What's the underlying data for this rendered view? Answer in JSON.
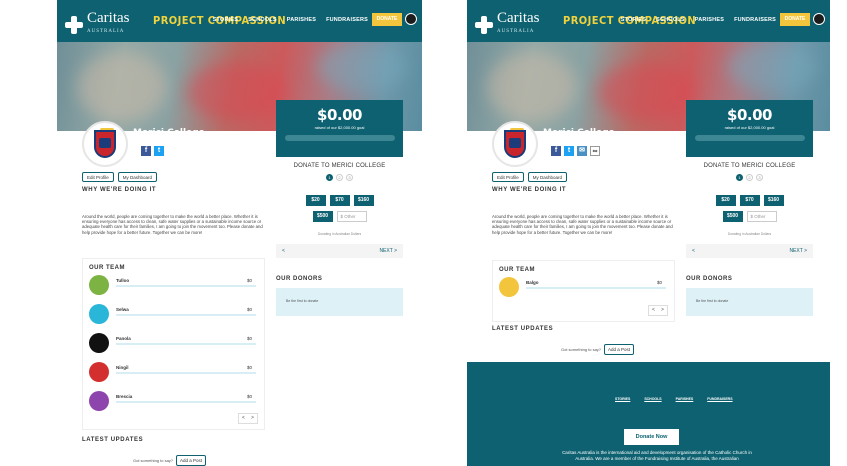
{
  "brand": {
    "name": "Caritas",
    "sub": "AUSTRALIA",
    "campaign": "PROJECT COMPASSION"
  },
  "nav": {
    "links": [
      "STORIES",
      "SCHOOLS",
      "PARISHES",
      "FUNDRAISERS"
    ],
    "donate": "DONATE"
  },
  "profile": {
    "school_name": "Merici College",
    "edit_profile": "Edit Profile",
    "my_dashboard": "My Dashboard"
  },
  "why": {
    "heading": "WHY WE'RE DOING IT",
    "text": "Around the world, people are coming together to make the world a better place. Whether it is ensuring everyone has access to clean, safe water supplies or a sustainable income source or adequate health care for their families, I am going to join the movement too. Please donate and help provide hope for a better future. Together we can be more!"
  },
  "donate": {
    "amount": "$0.00",
    "raised": "raised of our $2,000.00 goal",
    "progress": 0,
    "title": "DONATE TO MERICI COLLEGE",
    "steps": [
      "1",
      "2",
      "3"
    ],
    "amounts": [
      "$20",
      "$70",
      "$160"
    ],
    "big_amount": "$500",
    "other_placeholder": "$ Other",
    "currency_note": "Donating in Australian Dollars",
    "prev": "<",
    "next": "NEXT >"
  },
  "donors": {
    "heading": "OUR DONORS",
    "empty": "Be the first to donate"
  },
  "team_left": {
    "heading": "OUR TEAM",
    "members": [
      {
        "name": "Tulloo",
        "amount": "$0",
        "color": "#7cb342"
      },
      {
        "name": "Selwa",
        "amount": "$0",
        "color": "#29b6d8"
      },
      {
        "name": "Panola",
        "amount": "$0",
        "color": "#111111"
      },
      {
        "name": "Ningil",
        "amount": "$0",
        "color": "#d32f2f"
      },
      {
        "name": "Brescia",
        "amount": "$0",
        "color": "#8e44ad"
      }
    ],
    "pager_prev": "<",
    "pager_next": ">"
  },
  "team_right": {
    "heading": "OUR TEAM",
    "members": [
      {
        "name": "Balgo",
        "amount": "$0",
        "color": "#f2c53c"
      }
    ],
    "pager_prev": "<",
    "pager_next": ">"
  },
  "updates": {
    "heading": "LATEST UPDATES",
    "question": "Got something to say?",
    "add_post": "Add a Post"
  },
  "footer": {
    "links": [
      "STORIES",
      "SCHOOLS",
      "PARISHES",
      "FUNDRAISERS"
    ],
    "donate_now": "Donate Now",
    "text": "Caritas Australia is the international aid and development organisation of the Catholic Church in Australia. We are a member of the Fundraising Institute of Australia, the Australian"
  }
}
